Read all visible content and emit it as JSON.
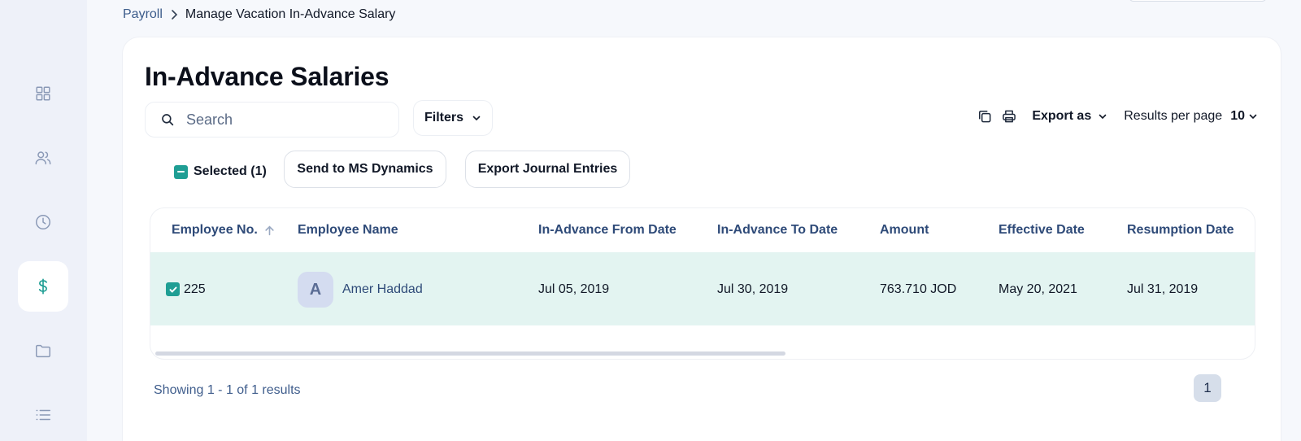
{
  "breadcrumb": {
    "root": "Payroll",
    "current": "Manage Vacation In-Advance Salary"
  },
  "sidebar": {
    "items": [
      {
        "icon": "grid-icon",
        "active": false
      },
      {
        "icon": "users-icon",
        "active": false
      },
      {
        "icon": "clock-icon",
        "active": false
      },
      {
        "icon": "dollar-icon",
        "active": true
      },
      {
        "icon": "folder-icon",
        "active": false
      },
      {
        "icon": "list-icon",
        "active": false
      }
    ]
  },
  "page": {
    "title": "In-Advance Salaries"
  },
  "toolbar": {
    "search_placeholder": "Search",
    "filters_label": "Filters",
    "export_label": "Export as",
    "results_per_page_label": "Results per page",
    "results_per_page_value": "10"
  },
  "actions": {
    "selected_label": "Selected (1)",
    "send_label": "Send to MS Dynamics",
    "journal_label": "Export Journal Entries"
  },
  "table": {
    "columns": [
      "Employee No.",
      "Employee Name",
      "In-Advance From Date",
      "In-Advance To Date",
      "Amount",
      "Effective Date",
      "Resumption Date"
    ],
    "rows": [
      {
        "employee_no": "225",
        "avatar_initial": "A",
        "employee_name": "Amer Haddad",
        "from_date": "Jul 05, 2019",
        "to_date": "Jul 30, 2019",
        "amount": "763.710 JOD",
        "effective_date": "May 20, 2021",
        "resumption_date": "Jul 31, 2019"
      }
    ]
  },
  "pagination": {
    "summary": "Showing 1 - 1 of 1 results",
    "current_page": "1"
  },
  "colors": {
    "accent": "#1f9e94",
    "row_selected": "#e3f4f1",
    "header_text": "#2e4a78"
  }
}
